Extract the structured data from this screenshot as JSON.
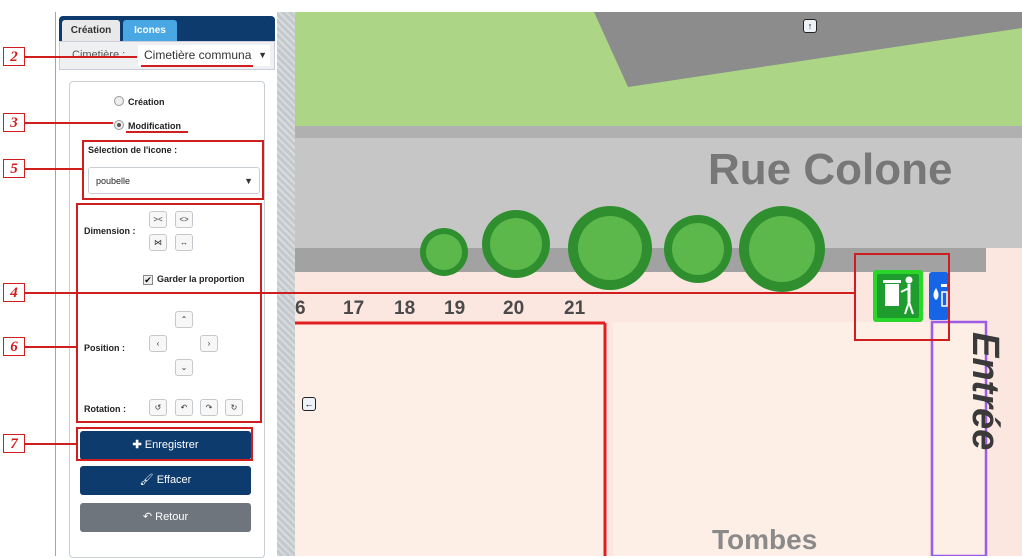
{
  "tabs": {
    "creation": "Création",
    "icones": "Icones"
  },
  "cemetery": {
    "label": "Cimetière :",
    "value": "Cimetière communa"
  },
  "mode": {
    "creation": "Création",
    "modification": "Modification",
    "selected": "Modification"
  },
  "icon_selection": {
    "label": "Sélection de l'icone :",
    "value": "poubelle"
  },
  "dimension": {
    "label": "Dimension :"
  },
  "keep_proportion": {
    "label": "Garder la proportion",
    "checked": true
  },
  "position": {
    "label": "Position :"
  },
  "rotation": {
    "label": "Rotation :"
  },
  "buttons": {
    "save": "Enregistrer",
    "erase": "Effacer",
    "back": "Retour"
  },
  "callouts": [
    "2",
    "3",
    "5",
    "4",
    "6",
    "7"
  ],
  "map": {
    "street": "Rue Colone",
    "entrance": "Entrée",
    "section": "Tombes",
    "plot_numbers": [
      "6",
      "17",
      "18",
      "19",
      "20",
      "21"
    ]
  },
  "colors": {
    "accent": "#0d3b6e",
    "tab_active": "#49a7e4",
    "callout": "#d01e1e",
    "grass": "#acd686",
    "road": "#c6c6c6",
    "icon_green": "#1e9d2e",
    "icon_blue": "#1565e6"
  }
}
